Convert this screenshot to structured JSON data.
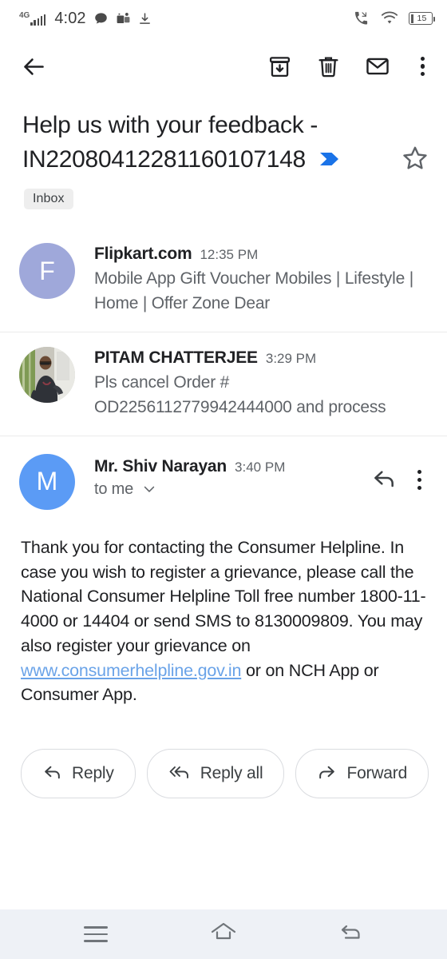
{
  "status_bar": {
    "network": "4G",
    "time": "4:02",
    "battery_level": "15",
    "left_icons": [
      "signal-icon",
      "chat-bubble-icon",
      "teams-icon",
      "download-icon"
    ],
    "right_icons": [
      "missed-call-icon",
      "wifi-icon",
      "battery-icon"
    ]
  },
  "toolbar": {
    "back_label": "Back",
    "archive_label": "Archive",
    "delete_label": "Delete",
    "mark_unread_label": "Mark as unread",
    "more_label": "More options"
  },
  "email": {
    "subject": "Help us with your feedback - IN22080412281160107148",
    "important_marker": true,
    "starred": false,
    "label": "Inbox",
    "messages": [
      {
        "sender": "Flipkart.com",
        "time": "12:35 PM",
        "snippet": "Mobile App Gift Voucher Mobiles | Lifestyle | Home | Offer Zone Dear",
        "avatar_letter": "F",
        "avatar_color": "#9fa8da",
        "avatar_type": "letter",
        "expanded": false
      },
      {
        "sender": "PITAM CHATTERJEE",
        "time": "3:29 PM",
        "snippet": "Pls cancel Order # OD2256112779942444000 and process",
        "avatar_letter": "",
        "avatar_color": "#cfd6cc",
        "avatar_type": "photo",
        "expanded": false
      },
      {
        "sender": "Mr. Shiv Narayan",
        "time": "3:40 PM",
        "recipient": "to me",
        "avatar_letter": "M",
        "avatar_color": "#5b9bf5",
        "avatar_type": "letter",
        "expanded": true,
        "body_part_1": "Thank you for contacting the Consumer Helpline. In case you wish to register a grievance, please call the National Consumer Helpline Toll free number 1800-11-4000 or 14404 or send SMS to 8130009809. You may also register your grievance on ",
        "body_link": "www.consumerhelpline.gov.in",
        "body_part_2": " or on NCH App or Consumer App."
      }
    ]
  },
  "actions": {
    "reply": "Reply",
    "reply_all": "Reply all",
    "forward": "Forward"
  },
  "nav_bar": {
    "recents_label": "Recents",
    "home_label": "Home",
    "back_label": "Back"
  },
  "colors": {
    "accent_blue": "#1a73e8",
    "link_blue": "#6aa3e8",
    "text_primary": "#202124",
    "text_secondary": "#5f6368",
    "nav_background": "#eef1f6",
    "chip_background": "#eeeeee"
  }
}
